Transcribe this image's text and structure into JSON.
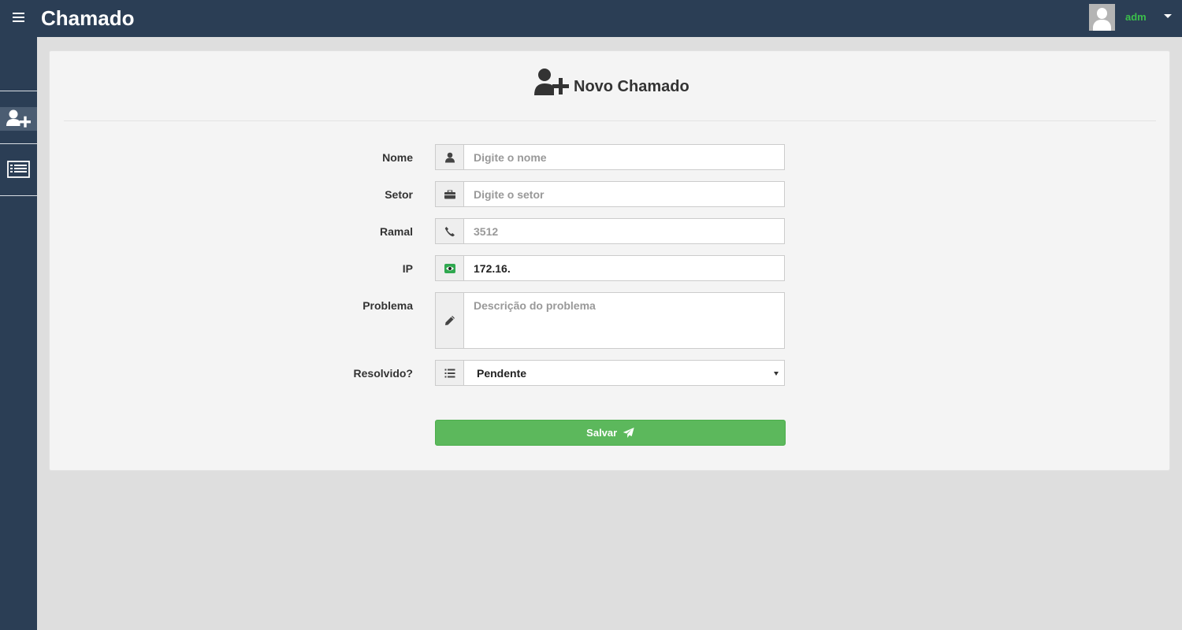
{
  "app": {
    "title": "Chamado"
  },
  "user": {
    "name": "adm"
  },
  "colors": {
    "accent_green": "#5cb85c",
    "topbar": "#2b3e55",
    "username": "#3bbf4b"
  },
  "sidebar": {
    "items": [
      {
        "icon": "user-plus-icon",
        "active": true
      },
      {
        "icon": "list-icon",
        "active": false
      }
    ]
  },
  "page": {
    "title": "Novo Chamado",
    "icon": "user-plus-icon"
  },
  "form": {
    "nome": {
      "label": "Nome",
      "placeholder": "Digite o nome",
      "icon": "user-icon"
    },
    "setor": {
      "label": "Setor",
      "placeholder": "Digite o setor",
      "icon": "briefcase-icon"
    },
    "ramal": {
      "label": "Ramal",
      "placeholder": "3512",
      "icon": "phone-icon"
    },
    "ip": {
      "label": "IP",
      "value": "172.16.",
      "icon": "eye-icon"
    },
    "problema": {
      "label": "Problema",
      "placeholder": "Descrição do problema",
      "icon": "pencil-icon"
    },
    "resolvido": {
      "label": "Resolvido?",
      "selected": "Pendente",
      "icon": "list-icon"
    },
    "save_label": "Salvar"
  }
}
